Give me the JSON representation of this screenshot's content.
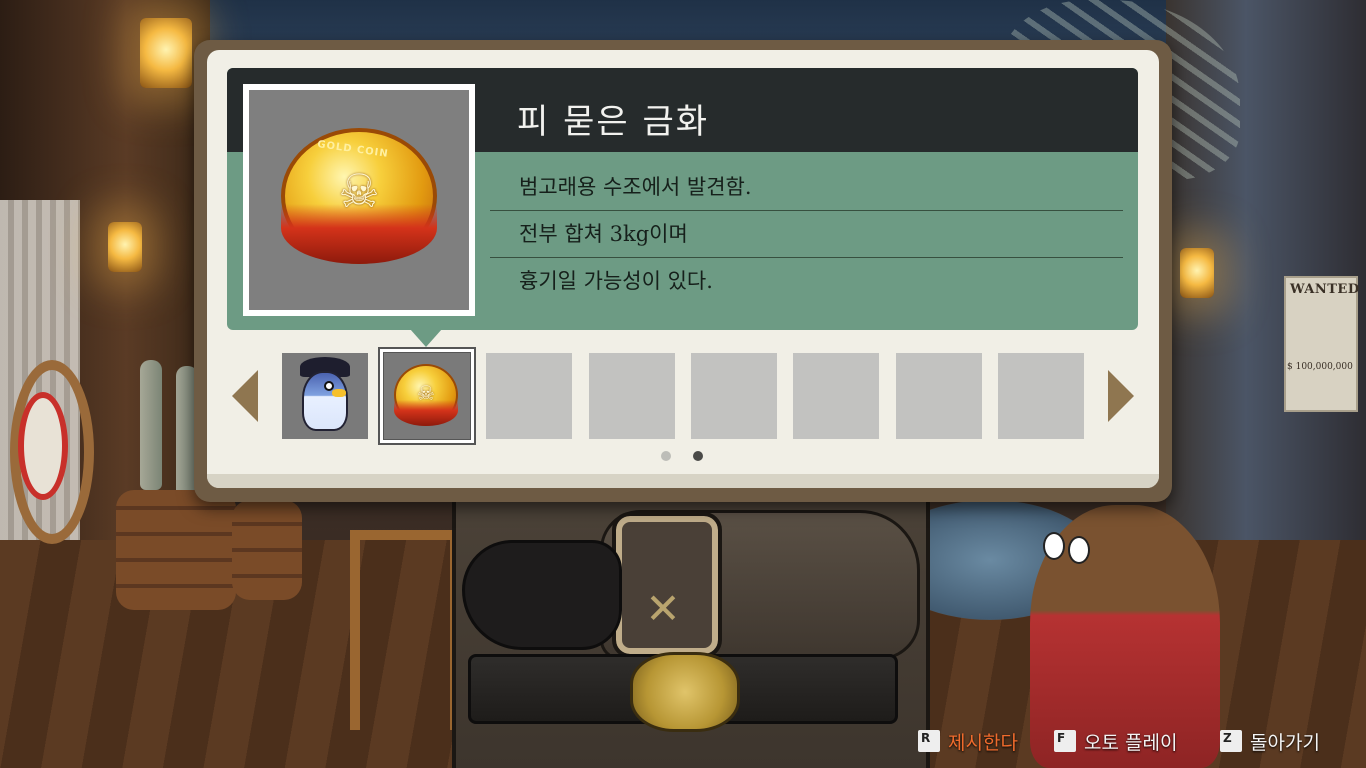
{
  "item": {
    "name": "피 묻은 금화",
    "description": [
      "범고래용 수조에서 발견함.",
      "전부 합쳐 3kg이며",
      "흉기일 가능성이 있다."
    ],
    "icon": "bloody-gold-coin",
    "coin_rim_text": "GOLD COIN"
  },
  "inventory": {
    "slots": [
      {
        "icon": "pirate-penguin-figure",
        "filled": true
      },
      {
        "icon": "bloody-gold-coin",
        "filled": true,
        "selected": true
      },
      {
        "filled": false
      },
      {
        "filled": false
      },
      {
        "filled": false
      },
      {
        "filled": false
      },
      {
        "filled": false
      },
      {
        "filled": false
      }
    ],
    "prev_icon": "arrow-left-icon",
    "next_icon": "arrow-right-icon",
    "page_count": 2,
    "current_page": 2
  },
  "controls": {
    "present": {
      "key": "R",
      "label": "제시한다"
    },
    "auto_play": {
      "key": "F",
      "label": "오토 플레이"
    },
    "back": {
      "key": "Z",
      "label": "돌아가기"
    }
  },
  "background": {
    "wanted_poster": {
      "title": "WANTED",
      "bounty": "$ 100,000,000"
    }
  },
  "colors": {
    "panel_frame": "#6e5b44",
    "info_green": "#6d9b84",
    "title_bar": "#262b2c",
    "present_accent": "#f06b2c"
  }
}
